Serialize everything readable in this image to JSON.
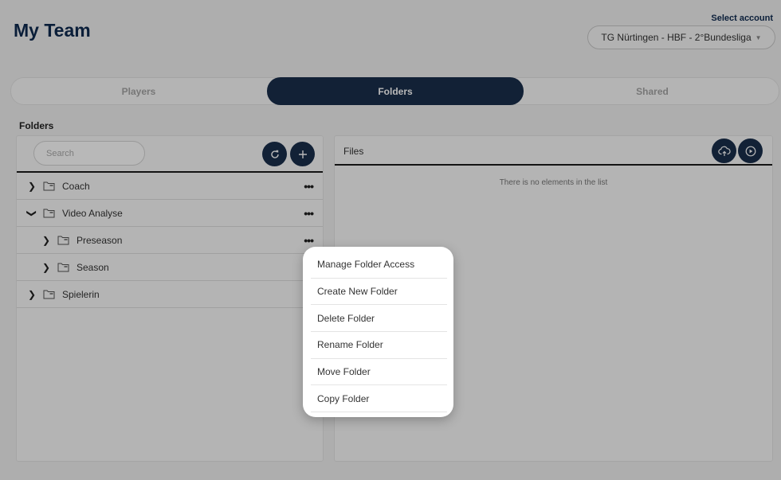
{
  "header": {
    "title": "My Team"
  },
  "account": {
    "label": "Select account",
    "selected": "TG Nürtingen - HBF - 2°Bundesliga"
  },
  "tabs": [
    {
      "label": "Players"
    },
    {
      "label": "Folders"
    },
    {
      "label": "Shared"
    }
  ],
  "folders_section": {
    "title": "Folders",
    "search_placeholder": "Search",
    "tree": [
      {
        "label": "Coach",
        "expanded": false,
        "depth": 0
      },
      {
        "label": "Video Analyse",
        "expanded": true,
        "depth": 0
      },
      {
        "label": "Preseason",
        "expanded": false,
        "depth": 1
      },
      {
        "label": "Season",
        "expanded": false,
        "depth": 1
      },
      {
        "label": "Spielerin",
        "expanded": false,
        "depth": 0
      }
    ]
  },
  "files_section": {
    "title": "Files",
    "empty_text": "There is no elements in the list"
  },
  "context_menu": {
    "items": [
      {
        "label": "Manage Folder Access"
      },
      {
        "label": "Create New Folder"
      },
      {
        "label": "Delete Folder"
      },
      {
        "label": "Rename Folder"
      },
      {
        "label": "Move Folder"
      },
      {
        "label": "Copy Folder"
      }
    ]
  },
  "icons": {
    "refresh": "refresh-icon",
    "add": "plus-icon",
    "upload": "cloud-upload-icon",
    "play": "play-circle-icon",
    "folder": "folder-icon",
    "more": "ellipsis-icon",
    "chevron_right": "chevron-right-icon",
    "chevron_down": "chevron-down-icon"
  },
  "colors": {
    "primary": "#1a2e4c",
    "title": "#0f2a50",
    "overlay": "rgba(0,0,0,0.28)"
  }
}
